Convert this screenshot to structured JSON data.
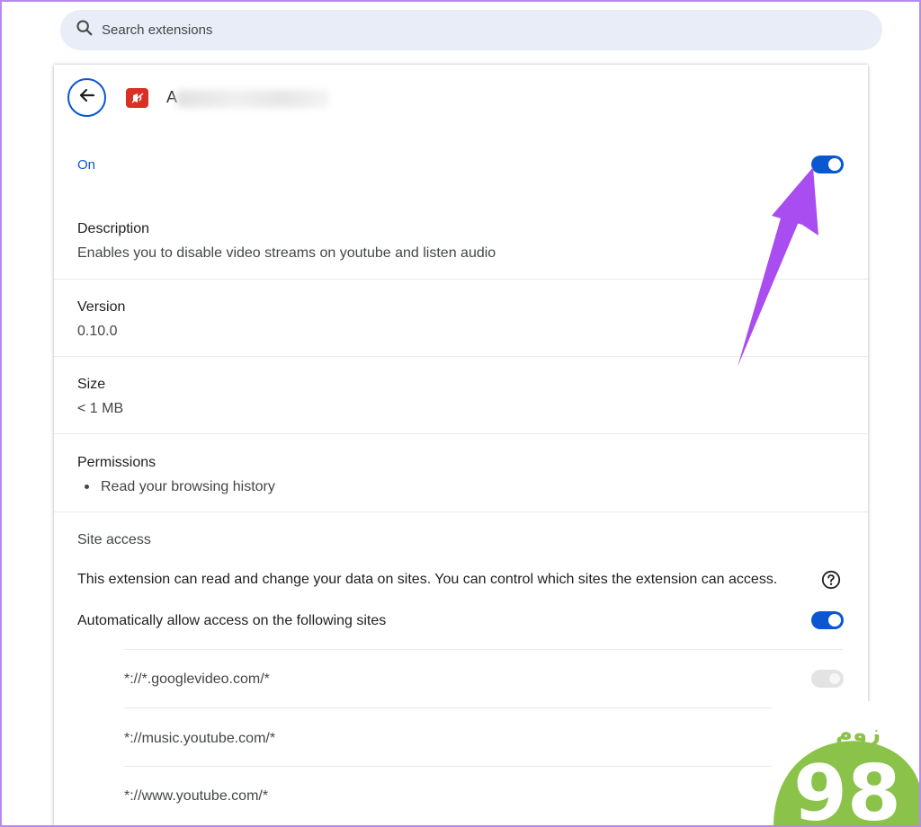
{
  "search": {
    "placeholder": "Search extensions",
    "icon": "search-icon"
  },
  "header": {
    "back_icon": "arrow-left-icon",
    "extension_icon": "extension-logo-icon",
    "extension_name_initial": "A"
  },
  "status": {
    "label": "On",
    "enabled": true
  },
  "description": {
    "title": "Description",
    "text": "Enables you to disable video streams on youtube and listen audio"
  },
  "version": {
    "title": "Version",
    "value": "0.10.0"
  },
  "size": {
    "title": "Size",
    "value": "< 1 MB"
  },
  "permissions": {
    "title": "Permissions",
    "items": [
      "Read your browsing history"
    ]
  },
  "site_access": {
    "title": "Site access",
    "description": "This extension can read and change your data on sites. You can control which sites the extension can access.",
    "auto_allow_label": "Automatically allow access on the following sites",
    "auto_allow_enabled": true,
    "sites": [
      {
        "pattern": "*://*.googlevideo.com/*",
        "enabled": true,
        "disabled_control": true
      },
      {
        "pattern": "*://music.youtube.com/*"
      },
      {
        "pattern": "*://www.youtube.com/*"
      }
    ]
  },
  "colors": {
    "accent": "#0b57d0",
    "annotation_arrow": "#a94df0",
    "watermark": "#8bc34a"
  },
  "watermark": {
    "number": "98",
    "text": "زوم"
  }
}
